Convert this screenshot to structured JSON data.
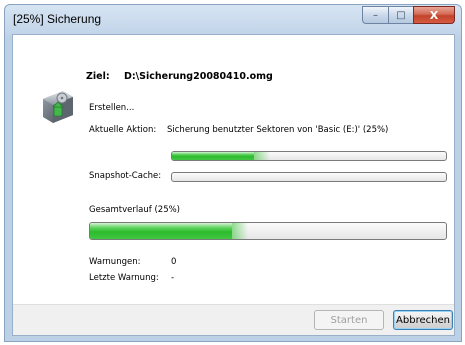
{
  "window": {
    "title": "[25%] Sicherung",
    "controls": {
      "minimize": "–",
      "maximize": "□",
      "close": "X"
    }
  },
  "target": {
    "label": "Ziel:",
    "path": "D:\\Sicherung20080410.omg"
  },
  "status": {
    "creating": "Erstellen...",
    "current_action_label": "Aktuelle Aktion:",
    "current_action_value": "Sicherung benutzter Sektoren von 'Basic (E:)' (25%)",
    "current_action_progress": 0.3
  },
  "snapshot": {
    "label": "Snapshot-Cache:",
    "progress": 0
  },
  "overall": {
    "label": "Gesamtverlauf (25%)",
    "progress": 0.4
  },
  "warnings": {
    "count_label": "Warnungen:",
    "count_value": "0",
    "last_label": "Letzte Warnung:",
    "last_value": "-"
  },
  "buttons": {
    "start": "Starten",
    "cancel": "Abbrechen"
  },
  "colors": {
    "progress_green": "#2dbb2d",
    "title_bar": "#c4d6ea",
    "close_red": "#c2432c"
  }
}
